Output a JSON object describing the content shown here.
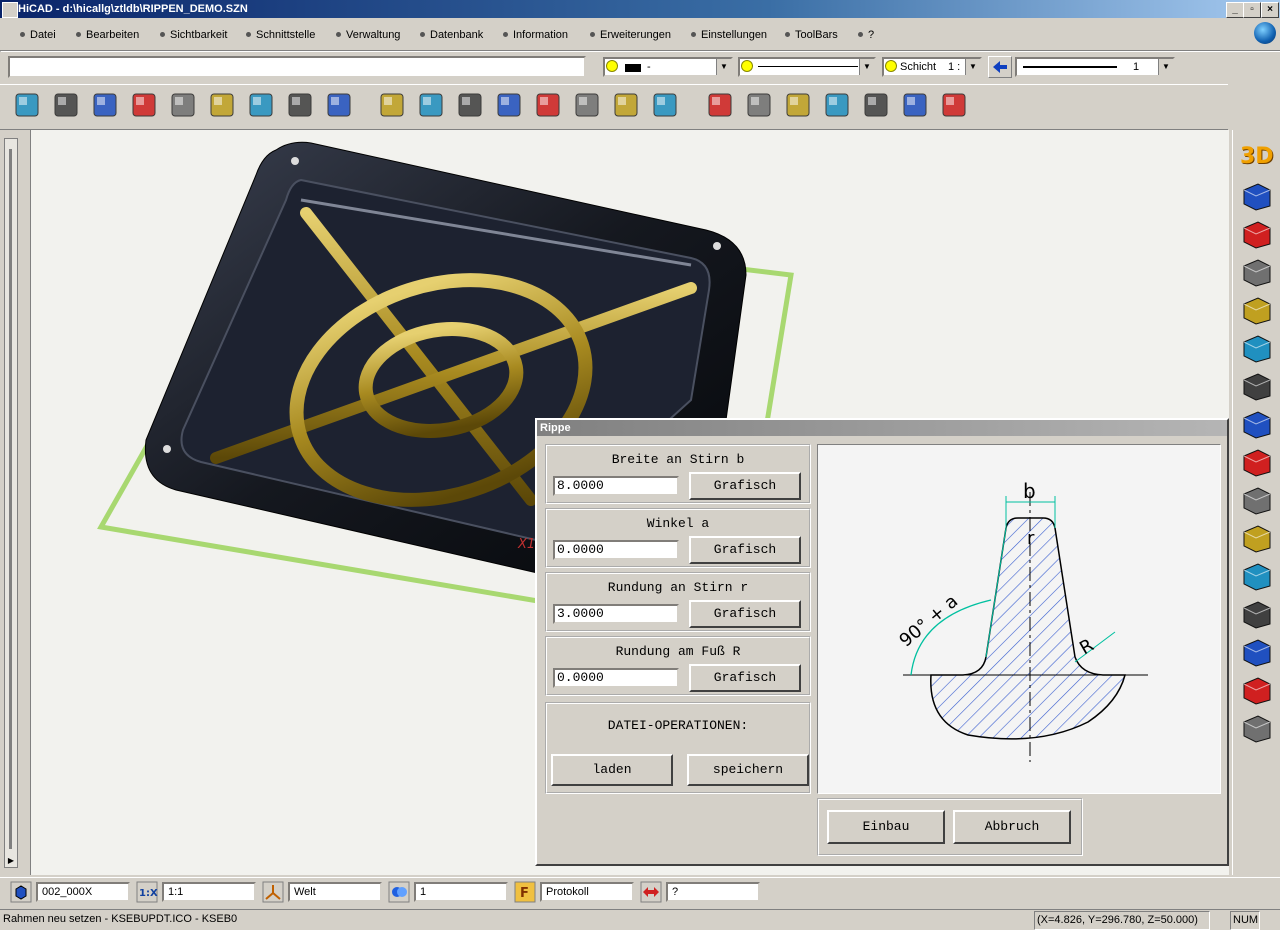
{
  "window": {
    "title": "HiCAD - d:\\hicallg\\ztldb\\RIPPEN_DEMO.SZN",
    "min_label": "_",
    "max_label": "▫",
    "close_label": "×"
  },
  "menu": [
    "Datei",
    "Bearbeiten",
    "Sichtbarkeit",
    "Schnittstelle",
    "Verwaltung",
    "Datenbank",
    "Information",
    "Erweiterungen",
    "Einstellungen",
    "ToolBars",
    "?"
  ],
  "toolbar2": {
    "command_value": "",
    "color_value": "-",
    "layer_label": "Schicht",
    "layer_value": "1 :",
    "linewidth_value": "1"
  },
  "icons": {
    "file": [
      "new-file-icon",
      "open-folder-icon",
      "save-disk-icon",
      "copy-documents-icon",
      "gear-part-icon",
      "delete-x-icon",
      "print-icon",
      "shade-icon",
      "list-icon"
    ],
    "view": [
      "gears-icon",
      "gears2-icon",
      "drawing-icon",
      "frame-icon",
      "zoom-window-icon",
      "zoom-icon",
      "undo-icon",
      "redo-icon"
    ],
    "model": [
      "rotate-icon",
      "cube-wire-icon",
      "cube-red-icon",
      "cube-side-icon",
      "cube-shaded-icon",
      "cube-section-icon",
      "rotate-view-icon"
    ],
    "side": [
      "3d-label",
      "beam-icon",
      "pipes-icon",
      "sheet-metal-icon",
      "profile-m-icon",
      "piping-icon",
      "frame-box-icon",
      "machine-icon",
      "valve-icon",
      "plug-icon",
      "gear-wheel-icon",
      "robot-arm-icon",
      "parts-icon",
      "stairs-icon",
      "texture-icon",
      "spring-icon"
    ]
  },
  "side_3d_label": "3D",
  "viewport": {
    "axis_label": "X1"
  },
  "dialog": {
    "title": "Rippe",
    "groups": [
      {
        "label": "Breite an Stirn b",
        "value": "8.0000",
        "button": "Grafisch"
      },
      {
        "label": "Winkel a",
        "value": "0.0000",
        "button": "Grafisch"
      },
      {
        "label": "Rundung an Stirn r",
        "value": "3.0000",
        "button": "Grafisch"
      },
      {
        "label": "Rundung am Fuß R",
        "value": "0.0000",
        "button": "Grafisch"
      }
    ],
    "file_ops": {
      "label": "DATEI-OPERATIONEN:",
      "load": "laden",
      "save": "speichern"
    },
    "diagram": {
      "label_b": "b",
      "label_r": "r",
      "label_R": "R",
      "label_angle": "90° + a"
    },
    "ok": "Einbau",
    "cancel": "Abbruch"
  },
  "statusbar": {
    "view_name": "002_000X",
    "scale": "1:1",
    "coord_system": "Welt",
    "layer": "1",
    "mode": "Protokoll",
    "help": "?",
    "message": "Rahmen neu setzen - KSEBUPDT.ICO - KSEB0",
    "coordinates": "(X=4.826, Y=296.780, Z=50.000)",
    "num": "NUM"
  },
  "colors": {
    "title_start": "#0a246a",
    "rib_gold": "#b8a030",
    "tray": "#1a1e28",
    "frame_green": "#8cd050",
    "hatch_blue": "#3a5fd0",
    "dim_cyan": "#00c0a0"
  }
}
